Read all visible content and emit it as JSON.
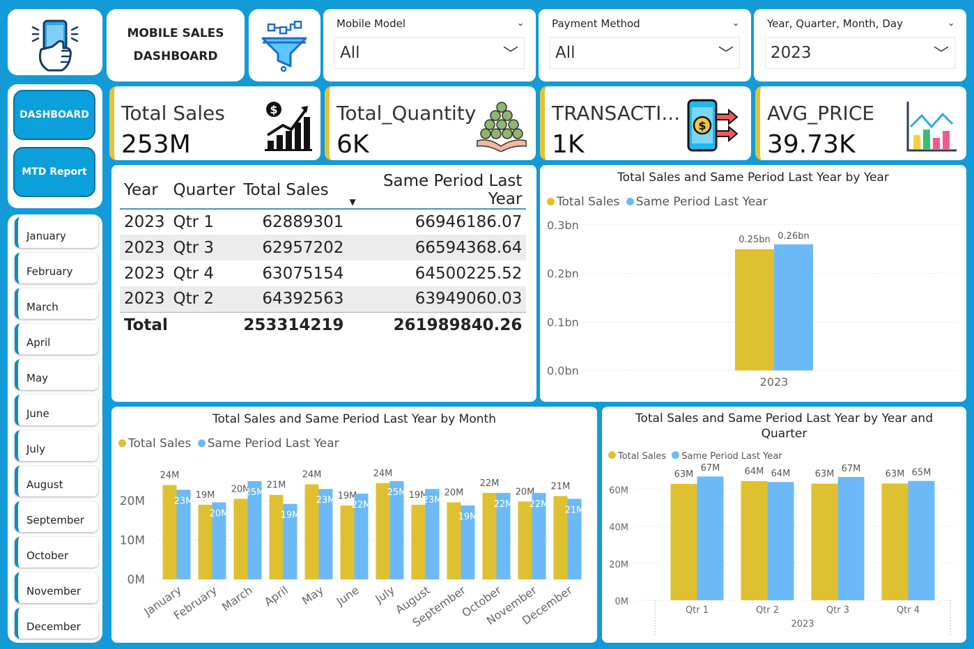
{
  "header": {
    "title_line1": "MOBILE SALES",
    "title_line2": "DASHBOARD"
  },
  "slicers": [
    {
      "label": "Mobile Model",
      "value": "All"
    },
    {
      "label": "Payment Method",
      "value": "All"
    },
    {
      "label": "Year, Quarter, Month, Day",
      "value": "2023"
    }
  ],
  "nav": {
    "dashboard": "DASHBOARD",
    "mtd": "MTD Report"
  },
  "months": [
    "January",
    "February",
    "March",
    "April",
    "May",
    "June",
    "July",
    "August",
    "September",
    "October",
    "November",
    "December"
  ],
  "kpis": [
    {
      "label": "Total Sales",
      "value": "253M"
    },
    {
      "label": "Total_Quantity",
      "value": "6K"
    },
    {
      "label": "TRANSACTI...",
      "value": "1K"
    },
    {
      "label": "AVG_PRICE",
      "value": "39.73K"
    }
  ],
  "table": {
    "headers": [
      "Year",
      "Quarter",
      "Total Sales",
      "Same Period Last Year"
    ],
    "rows": [
      [
        "2023",
        "Qtr 1",
        "62889301",
        "66946186.07"
      ],
      [
        "2023",
        "Qtr 3",
        "62957202",
        "66594368.64"
      ],
      [
        "2023",
        "Qtr 4",
        "63075154",
        "64500225.52"
      ],
      [
        "2023",
        "Qtr 2",
        "64392563",
        "63949060.03"
      ]
    ],
    "total": [
      "Total",
      "253314219",
      "261989840.26"
    ]
  },
  "colors": {
    "total_sales": "#dfc030",
    "last_year": "#6cb9f8",
    "background": "#149ad6"
  },
  "chart_data": [
    {
      "type": "bar",
      "title": "Total Sales and Same Period Last Year by Year",
      "legend": [
        "Total Sales",
        "Same Period Last Year"
      ],
      "categories": [
        "2023"
      ],
      "series": [
        {
          "name": "Total Sales",
          "values": [
            0.25
          ],
          "labels": [
            "0.25bn"
          ]
        },
        {
          "name": "Same Period Last Year",
          "values": [
            0.26
          ],
          "labels": [
            "0.26bn"
          ]
        }
      ],
      "yticks": [
        "0.0bn",
        "0.1bn",
        "0.2bn",
        "0.3bn"
      ],
      "ylim": [
        0,
        0.3
      ]
    },
    {
      "type": "bar",
      "title": "Total Sales and Same Period Last Year by Month",
      "legend": [
        "Total Sales",
        "Same Period Last Year"
      ],
      "categories": [
        "January",
        "February",
        "March",
        "April",
        "May",
        "June",
        "July",
        "August",
        "September",
        "October",
        "November",
        "December"
      ],
      "series": [
        {
          "name": "Total Sales",
          "values": [
            24,
            19,
            20.5,
            21.5,
            24.2,
            18.8,
            24.5,
            19,
            19.6,
            22,
            19.8,
            21.2
          ],
          "labels": [
            "24M",
            "19M",
            "20M",
            "21M",
            "24M",
            "19M",
            "24M",
            "19M",
            "20M",
            "22M",
            "20M",
            "21M"
          ]
        },
        {
          "name": "Same Period Last Year",
          "values": [
            22.8,
            19.6,
            25,
            19.2,
            23,
            21.8,
            25,
            23,
            18.8,
            22,
            22,
            20.5
          ],
          "labels": [
            "23M",
            "20M",
            "25M",
            "19M",
            "23M",
            "22M",
            "25M",
            "23M",
            "19M",
            "22M",
            "22M",
            "21M"
          ]
        }
      ],
      "yticks": [
        "0M",
        "10M",
        "20M"
      ],
      "ylim": [
        0,
        28
      ]
    },
    {
      "type": "bar",
      "title": "Total Sales and Same Period Last Year by Year and Quarter",
      "legend": [
        "Total Sales",
        "Same Period Last Year"
      ],
      "categories": [
        "Qtr 1",
        "Qtr 2",
        "Qtr 3",
        "Qtr 4"
      ],
      "group_label": "2023",
      "series": [
        {
          "name": "Total Sales",
          "values": [
            62.9,
            64.4,
            63.0,
            63.1
          ],
          "labels": [
            "63M",
            "64M",
            "63M",
            "63M"
          ]
        },
        {
          "name": "Same Period Last Year",
          "values": [
            66.9,
            63.9,
            66.6,
            64.5
          ],
          "labels": [
            "67M",
            "64M",
            "67M",
            "65M"
          ]
        }
      ],
      "yticks": [
        "0M",
        "20M",
        "40M",
        "60M"
      ],
      "ylim": [
        0,
        70
      ]
    }
  ]
}
